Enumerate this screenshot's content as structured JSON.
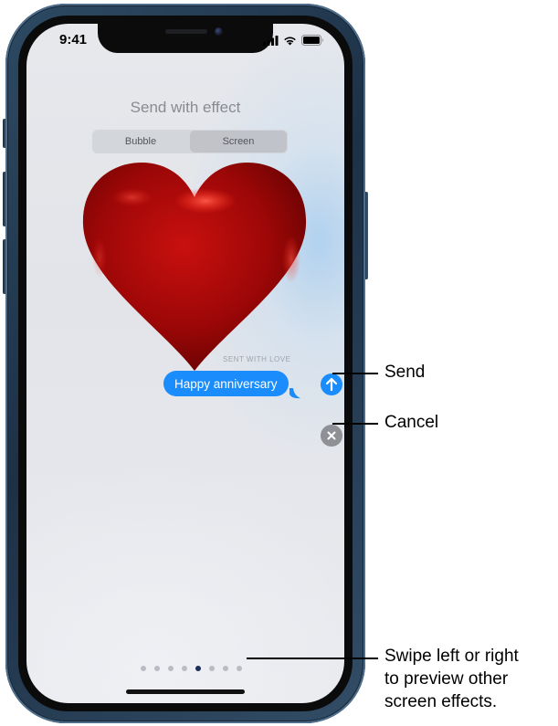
{
  "status_bar": {
    "time": "9:41",
    "icons": [
      "cellular-signal-icon",
      "wifi-icon",
      "battery-icon"
    ]
  },
  "screen": {
    "title": "Send with effect",
    "segments": [
      {
        "label": "Bubble",
        "selected": false
      },
      {
        "label": "Screen",
        "selected": true
      }
    ],
    "effect_name": "SENT WITH LOVE",
    "message_text": "Happy anniversary",
    "send_icon": "arrow-up-icon",
    "cancel_icon": "close-icon",
    "page_indicator": {
      "count": 8,
      "current": 5
    }
  },
  "callouts": {
    "send": "Send",
    "cancel": "Cancel",
    "swipe_line1": "Swipe left or right",
    "swipe_line2": "to preview other",
    "swipe_line3": "screen effects."
  },
  "colors": {
    "accent_blue": "#1a8cfb",
    "cancel_gray": "#8e9096",
    "heart_red": "#c40a0a",
    "frame_blue": "#2d4a63"
  }
}
